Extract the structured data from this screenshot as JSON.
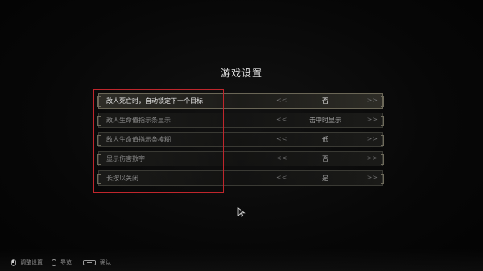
{
  "title": "游戏设置",
  "settings": [
    {
      "label": "敌人死亡时，自动锁定下一个目标",
      "value": "否",
      "active": true
    },
    {
      "label": "敌人生命值指示条显示",
      "value": "击中时显示",
      "active": false
    },
    {
      "label": "敌人生命值指示条模糊",
      "value": "低",
      "active": false
    },
    {
      "label": "显示伤害数字",
      "value": "否",
      "active": false
    },
    {
      "label": "长按以关闭",
      "value": "是",
      "active": false
    }
  ],
  "arrows": {
    "left": "<<",
    "right": ">>"
  },
  "footer": {
    "adjust": {
      "label": "调整设置",
      "icon": "mouse-left-icon"
    },
    "navigate": {
      "label": "导览",
      "icon": "mouse-icon"
    },
    "confirm": {
      "label": "确认",
      "icon": "spacebar-icon"
    }
  },
  "colors": {
    "highlight_box": "#c0262c",
    "background": "#060606"
  }
}
